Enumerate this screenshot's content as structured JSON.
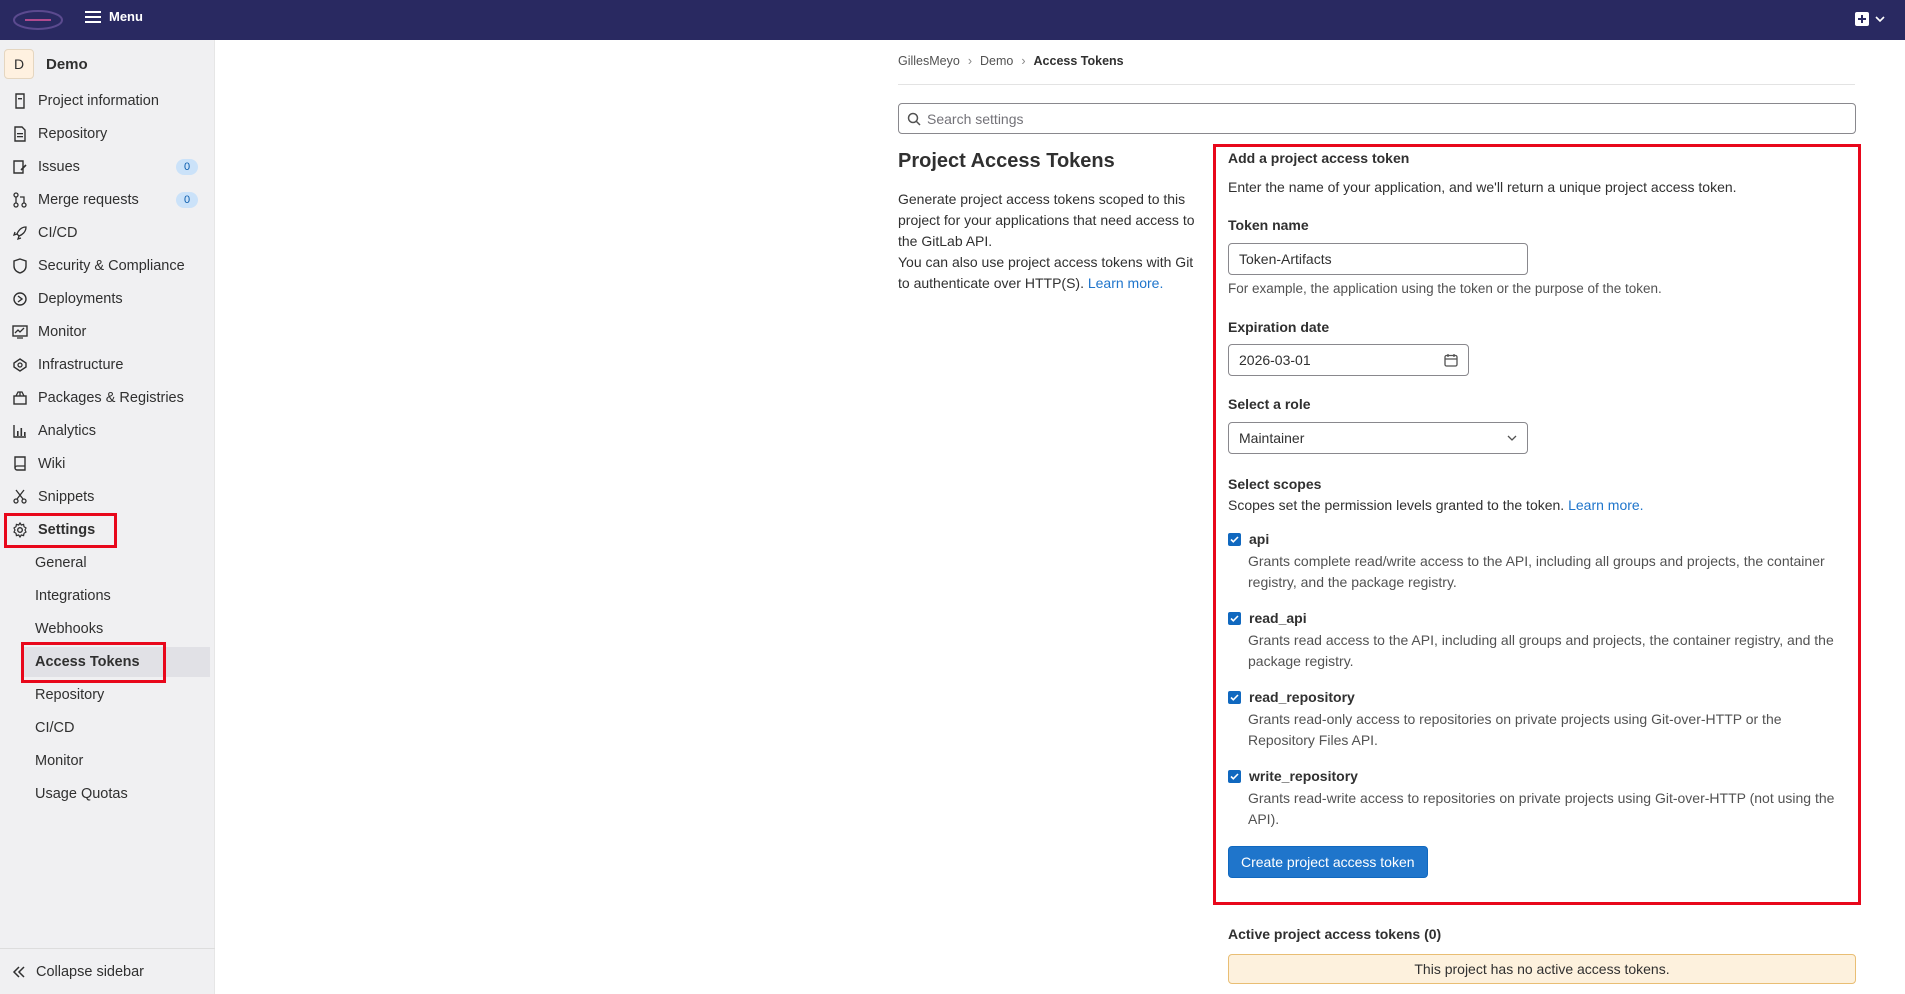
{
  "topbar": {
    "menu_label": "Menu",
    "brand_color": "#292961"
  },
  "project": {
    "avatar_letter": "D",
    "name": "Demo"
  },
  "sidebar": {
    "items": [
      {
        "label": "Project information",
        "icon": "project-info-icon"
      },
      {
        "label": "Repository",
        "icon": "repository-icon"
      },
      {
        "label": "Issues",
        "icon": "issues-icon",
        "badge": "0"
      },
      {
        "label": "Merge requests",
        "icon": "merge-request-icon",
        "badge": "0"
      },
      {
        "label": "CI/CD",
        "icon": "rocket-icon"
      },
      {
        "label": "Security & Compliance",
        "icon": "shield-icon"
      },
      {
        "label": "Deployments",
        "icon": "deployments-icon"
      },
      {
        "label": "Monitor",
        "icon": "monitor-icon"
      },
      {
        "label": "Infrastructure",
        "icon": "cloud-icon"
      },
      {
        "label": "Packages & Registries",
        "icon": "package-icon"
      },
      {
        "label": "Analytics",
        "icon": "analytics-icon"
      },
      {
        "label": "Wiki",
        "icon": "book-icon"
      },
      {
        "label": "Snippets",
        "icon": "scissors-icon"
      },
      {
        "label": "Settings",
        "icon": "gear-icon"
      }
    ],
    "settings_sub": [
      "General",
      "Integrations",
      "Webhooks",
      "Access Tokens",
      "Repository",
      "CI/CD",
      "Monitor",
      "Usage Quotas"
    ],
    "collapse_label": "Collapse sidebar"
  },
  "breadcrumb": [
    "GillesMeyo",
    "Demo",
    "Access Tokens"
  ],
  "search": {
    "placeholder": "Search settings"
  },
  "section": {
    "title": "Project Access Tokens",
    "desc1": "Generate project access tokens scoped to this project for your applications that need access to the GitLab API.",
    "desc2": "You can also use project access tokens with Git to authenticate over HTTP(S).",
    "learn_more": "Learn more."
  },
  "form": {
    "title": "Add a project access token",
    "subtitle": "Enter the name of your application, and we'll return a unique project access token.",
    "token_name_label": "Token name",
    "token_name_value": "Token-Artifacts",
    "token_name_help": "For example, the application using the token or the purpose of the token.",
    "expiration_label": "Expiration date",
    "expiration_value": "2026-03-01",
    "role_label": "Select a role",
    "role_value": "Maintainer",
    "scopes_label": "Select scopes",
    "scopes_help": "Scopes set the permission levels granted to the token.",
    "scopes_learn_more": "Learn more.",
    "scopes": [
      {
        "name": "api",
        "checked": true,
        "desc": "Grants complete read/write access to the API, including all groups and projects, the container registry, and the package registry."
      },
      {
        "name": "read_api",
        "checked": true,
        "desc": "Grants read access to the API, including all groups and projects, the container registry, and the package registry."
      },
      {
        "name": "read_repository",
        "checked": true,
        "desc": "Grants read-only access to repositories on private projects using Git-over-HTTP or the Repository Files API."
      },
      {
        "name": "write_repository",
        "checked": true,
        "desc": "Grants read-write access to repositories on private projects using Git-over-HTTP (not using the API)."
      }
    ],
    "submit_label": "Create project access token"
  },
  "active_tokens": {
    "title": "Active project access tokens (0)",
    "empty_message": "This project has no active access tokens."
  },
  "colors": {
    "accent": "#1f75cb",
    "highlight": "#e8071b",
    "alert_bg": "#fdf1dd"
  }
}
